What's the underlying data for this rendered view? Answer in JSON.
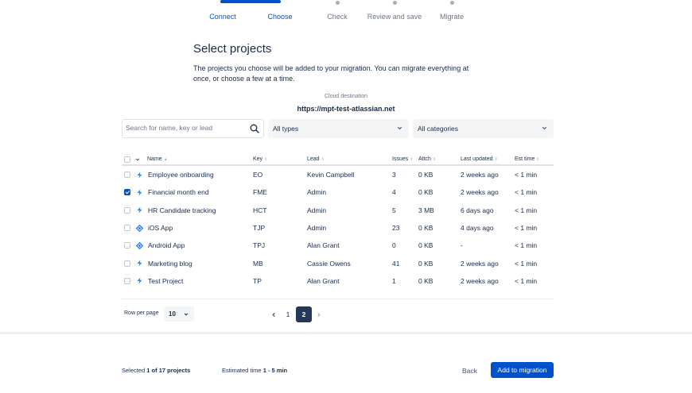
{
  "stepper": [
    {
      "label": "Connect",
      "state": "complete"
    },
    {
      "label": "Choose",
      "state": "current"
    },
    {
      "label": "Check",
      "state": "pending"
    },
    {
      "label": "Review and save",
      "state": "pending"
    },
    {
      "label": "Migrate",
      "state": "pending"
    }
  ],
  "page": {
    "title": "Select projects",
    "description": "The projects you choose will be added to your migration. You can migrate everything at once, or choose a few at a time.",
    "cloud_label": "Cloud destination",
    "cloud_url": "https://mpt-test-atlassian.net"
  },
  "filters": {
    "search_placeholder": "Search for name, key or lead",
    "type_value": "All types",
    "category_value": "All categories"
  },
  "table": {
    "headers": {
      "name": "Name",
      "key": "Key",
      "lead": "Lead",
      "issues": "Issues",
      "attachments": "Attch",
      "last_updated": "Last updated",
      "est_time": "Est time"
    },
    "rows": [
      {
        "name": "Employee onboarding",
        "key": "EO",
        "lead": "Kevin Campbell",
        "issues": "3",
        "attachments": "0 KB",
        "last_updated": "2 weeks ago",
        "est_time": "< 1 min",
        "checked": false,
        "icon": "lightning-icon"
      },
      {
        "name": "Financial month end",
        "key": "FME",
        "lead": "Admin",
        "issues": "4",
        "attachments": "0 KB",
        "last_updated": "2 weeks ago",
        "est_time": "< 1 min",
        "checked": true,
        "icon": "lightning-icon"
      },
      {
        "name": "HR Candidate tracking",
        "key": "HCT",
        "lead": "Admin",
        "issues": "5",
        "attachments": "3 MB",
        "last_updated": "6 days ago",
        "est_time": "< 1 min",
        "checked": false,
        "icon": "lightning-icon"
      },
      {
        "name": "iOS App",
        "key": "TJP",
        "lead": "Admin",
        "issues": "23",
        "attachments": "0 KB",
        "last_updated": "4 days ago",
        "est_time": "< 1 min",
        "checked": false,
        "icon": "software-icon"
      },
      {
        "name": "Android App",
        "key": "TPJ",
        "lead": "Alan Grant",
        "issues": "0",
        "attachments": "0 KB",
        "last_updated": "-",
        "est_time": "< 1 min",
        "checked": false,
        "icon": "software-icon"
      },
      {
        "name": "Marketing blog",
        "key": "MB",
        "lead": "Cassie Owens",
        "issues": "41",
        "attachments": "0 KB",
        "last_updated": "2 weeks ago",
        "est_time": "< 1 min",
        "checked": false,
        "icon": "lightning-icon"
      },
      {
        "name": "Test Project",
        "key": "TP",
        "lead": "Alan Grant",
        "issues": "1",
        "attachments": "0 KB",
        "last_updated": "2 weeks ago",
        "est_time": "< 1 min",
        "checked": false,
        "icon": "lightning-icon"
      }
    ]
  },
  "pagination": {
    "rows_per_page_label": "Row per page",
    "rows_per_page": "10",
    "pages": [
      "1",
      "2"
    ],
    "current_page": "2"
  },
  "footer": {
    "selected_prefix": "Selected ",
    "selected_value": "1 of 17 projects",
    "estimated_prefix": "Estimated time ",
    "estimated_value": "1 - 5 min",
    "back_label": "Back",
    "add_label": "Add to migration"
  },
  "colors": {
    "primary": "#0052cc",
    "text": "#172b4d",
    "muted": "#6b778c",
    "pending_dot": "#a5adba",
    "current_page_bg": "#253858"
  }
}
